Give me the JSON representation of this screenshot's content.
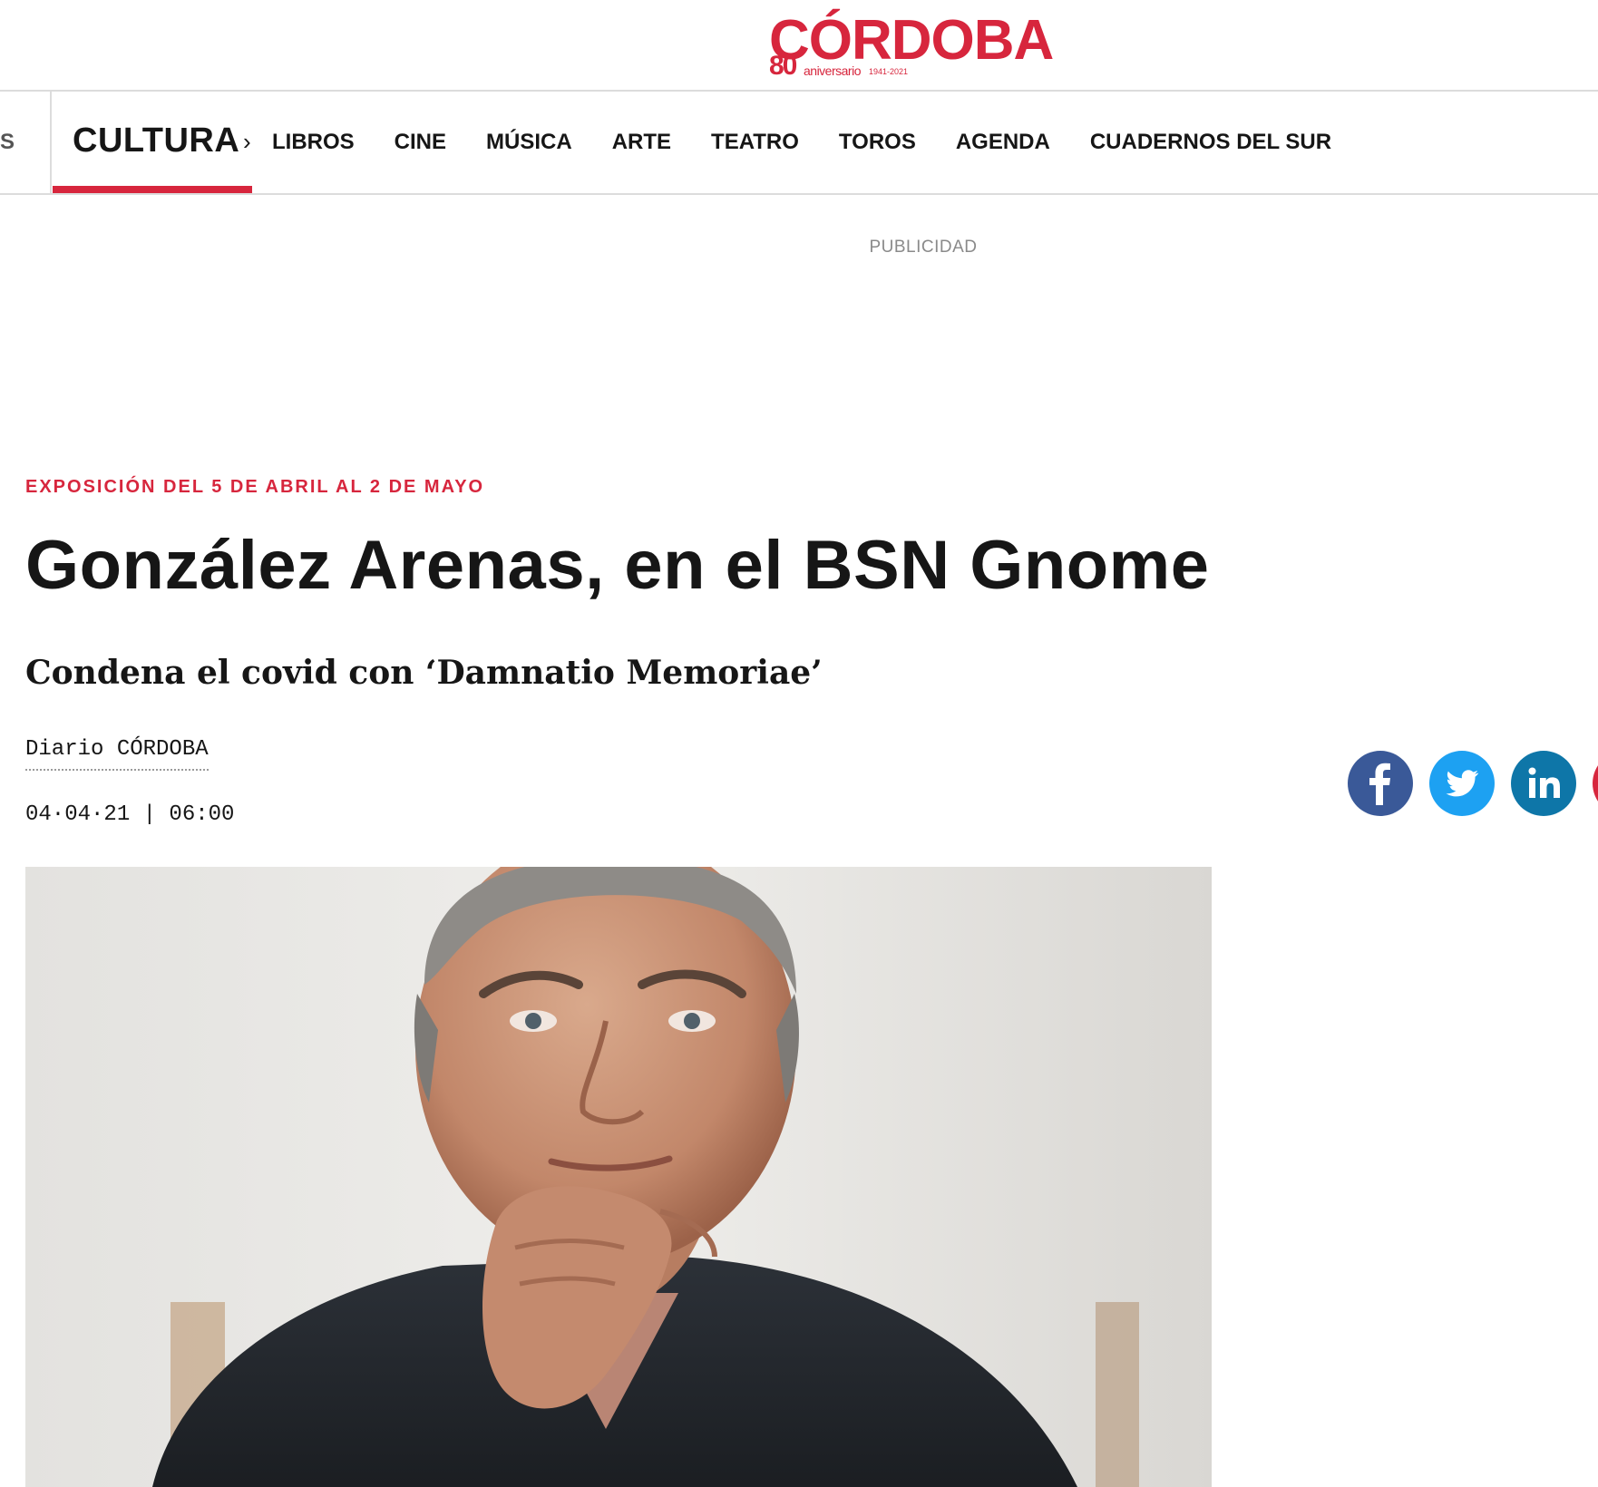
{
  "logo": {
    "wordmark": "CÓRDOBA",
    "anniversary_number": "80",
    "anniversary_text": "aniversario",
    "anniversary_years": "1941-2021",
    "brand_color": "#d7263d"
  },
  "nav": {
    "previous_label": "S",
    "current_section": "CULTURA",
    "items": [
      "LIBROS",
      "CINE",
      "MÚSICA",
      "ARTE",
      "TEATRO",
      "TOROS",
      "AGENDA",
      "CUADERNOS DEL SUR"
    ]
  },
  "ad": {
    "label": "PUBLICIDAD"
  },
  "article": {
    "kicker": "EXPOSICIÓN DEL 5 DE ABRIL AL 2 DE MAYO",
    "headline": "González Arenas, en el BSN Gnome",
    "subheadline": "Condena el covid con ‘Damnatio Memoriae’",
    "byline": "Diario CÓRDOBA",
    "date": "04·04·21 | 06:00"
  },
  "share": {
    "buttons": [
      {
        "name": "facebook",
        "icon": "facebook-icon",
        "color": "#3a5998"
      },
      {
        "name": "twitter",
        "icon": "twitter-icon",
        "color": "#1da1f2"
      },
      {
        "name": "linkedin",
        "icon": "linkedin-icon",
        "color": "#0e76a8"
      },
      {
        "name": "more",
        "icon": "share-icon",
        "color": "#d7263d"
      }
    ]
  }
}
